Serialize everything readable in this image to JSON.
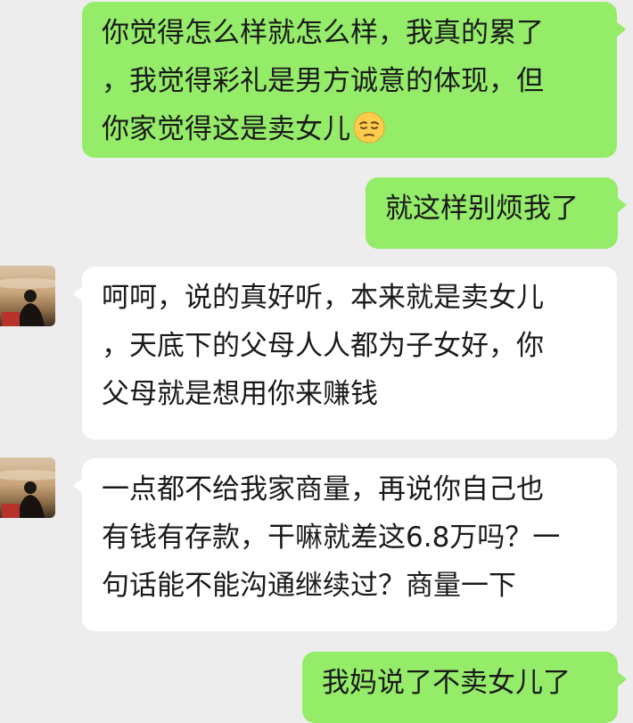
{
  "messages": [
    {
      "side": "sent",
      "lines": [
        "你觉得怎么样就怎么样，我真的累了",
        "，我觉得彩礼是男方诚意的体现，但",
        "你家觉得这是卖女儿"
      ],
      "trailing_emoji": "pensive-face-icon"
    },
    {
      "side": "sent",
      "lines": [
        "就这样别烦我了"
      ]
    },
    {
      "side": "received",
      "avatar": "contact-avatar",
      "lines": [
        "呵呵，说的真好听，本来就是卖女儿",
        "，天底下的父母人人都为子女好，你",
        "父母就是想用你来赚钱"
      ]
    },
    {
      "side": "received",
      "avatar": "contact-avatar",
      "lines": [
        "一点都不给我家商量，再说你自己也",
        "有钱有存款，干嘛就差这6.8万吗？一",
        "句话能不能沟通继续过？商量一下"
      ]
    },
    {
      "side": "sent",
      "lines": [
        "我妈说了不卖女儿了"
      ]
    }
  ],
  "colors": {
    "background": "#ededed",
    "sent_bubble": "#95ec69",
    "received_bubble": "#ffffff",
    "text": "#1a1a1a"
  }
}
